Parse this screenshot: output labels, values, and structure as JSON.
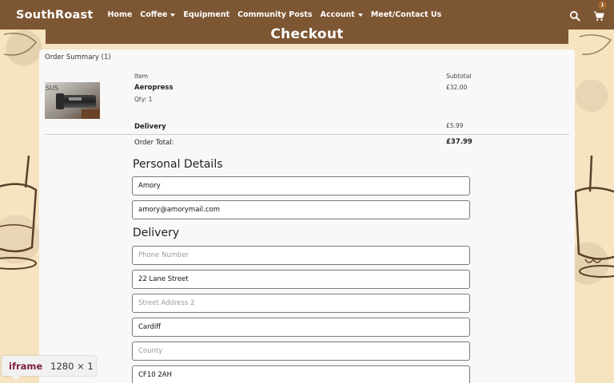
{
  "nav": {
    "brand": "SouthRoast",
    "links": [
      "Home",
      "Coffee",
      "Equipment",
      "Community Posts",
      "Account",
      "Meet/Contact Us"
    ],
    "cart_count": "1"
  },
  "page": {
    "title": "Checkout"
  },
  "order": {
    "summary_title": "Order Summary (1)",
    "col_item": "Item",
    "col_subtotal": "Subtotal",
    "product_name": "Aeropress",
    "product_qty": "Qty: 1",
    "product_price": "£32.00",
    "product_image_text": "SUS",
    "delivery_label": "Delivery",
    "delivery_price": "£5.99",
    "total_label": "Order Total:",
    "total_value": "£37.99"
  },
  "personal": {
    "title": "Personal Details",
    "name": "Amory",
    "email": "amory@amorymail.com"
  },
  "delivery": {
    "title": "Delivery",
    "phone_placeholder": "Phone Number",
    "street1": "22 Lane Street",
    "street2_placeholder": "Street Address 2",
    "city": "Cardiff",
    "county_placeholder": "County",
    "postcode": "CF10 2AH"
  },
  "devtools": {
    "tag": "iframe",
    "dims": "1280 × 1"
  },
  "colors": {
    "navbar": "#7d5633",
    "background": "#f6e3c0",
    "card": "#f8f8f9"
  }
}
